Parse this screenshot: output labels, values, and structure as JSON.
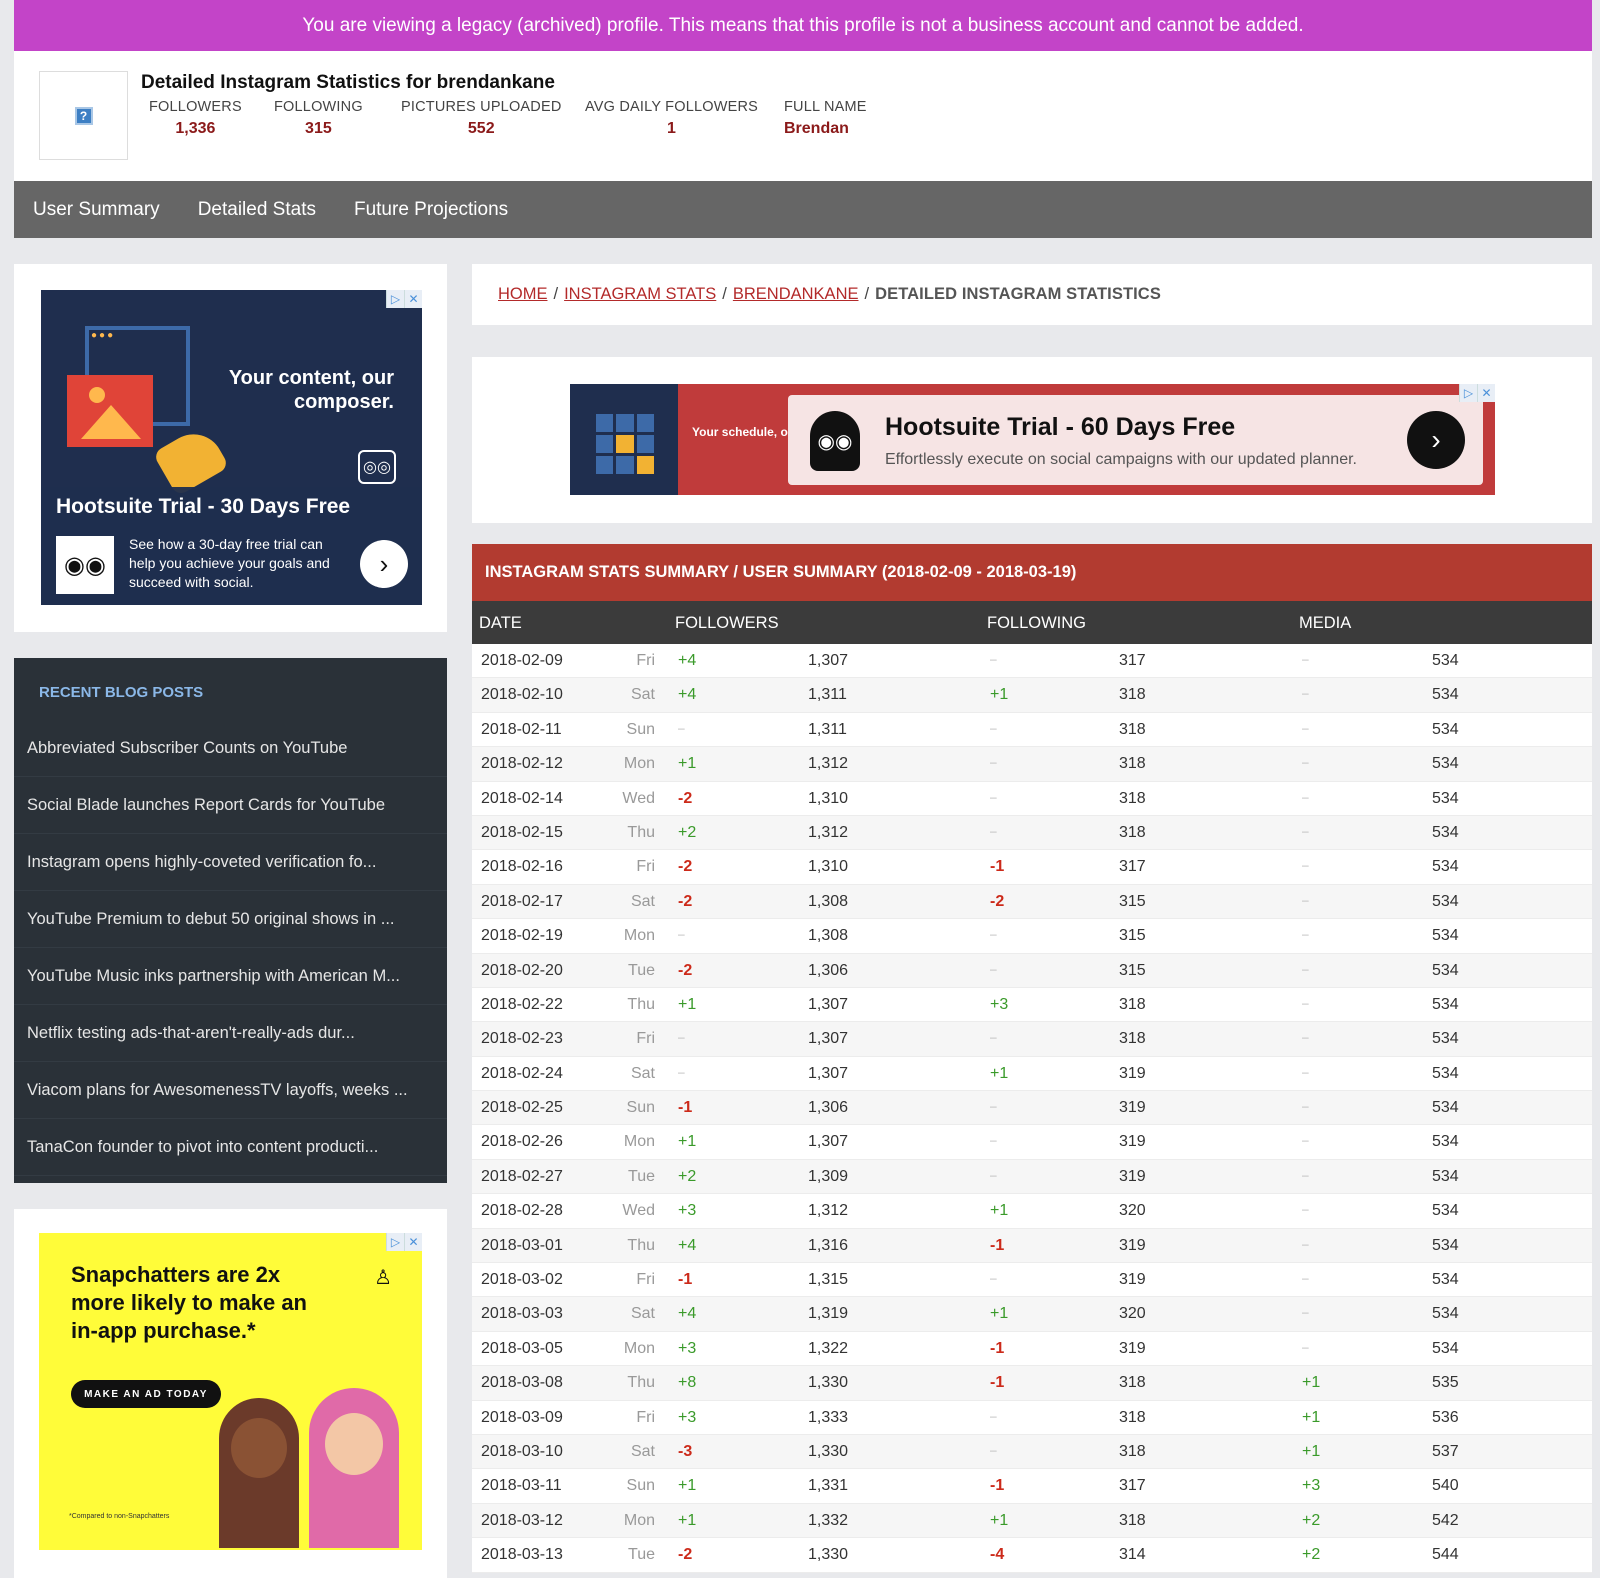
{
  "banner": "You are viewing a legacy (archived) profile. This means that this profile is not a business account and cannot be added.",
  "profile": {
    "avatar_glyph": "?",
    "title": "Detailed Instagram Statistics for brendankane",
    "stats": [
      {
        "label": "FOLLOWERS",
        "value": "1,336"
      },
      {
        "label": "FOLLOWING",
        "value": "315"
      },
      {
        "label": "PICTURES UPLOADED",
        "value": "552"
      },
      {
        "label": "AVG DAILY FOLLOWERS",
        "value": "1"
      },
      {
        "label": "FULL NAME",
        "value": "Brendan"
      }
    ]
  },
  "nav": [
    "User Summary",
    "Detailed Stats",
    "Future Projections"
  ],
  "ad_left": {
    "headline": "Your content, our composer.",
    "title": "Hootsuite Trial - 30 Days Free",
    "text": "See how a 30-day free trial can help you achieve your goals and succeed with social.",
    "cta": "›"
  },
  "blog": {
    "title": "RECENT BLOG POSTS",
    "items": [
      "Abbreviated Subscriber Counts on YouTube",
      "Social Blade launches Report Cards for YouTube",
      "Instagram opens highly-coveted verification fo...",
      "YouTube Premium to debut 50 original shows in ...",
      "YouTube Music inks partnership with American M...",
      "Netflix testing ads-that-aren't-really-ads dur...",
      "Viacom plans for AwesomenessTV layoffs, weeks ...",
      "TanaCon founder to pivot into content producti..."
    ]
  },
  "ad_snap": {
    "headline": "Snapchatters are 2x more likely to make an in-app purchase.*",
    "button": "MAKE AN AD TODAY",
    "fine": "*Compared to non-Snapchatters"
  },
  "breadcrumb": {
    "home": "HOME",
    "stats": "INSTAGRAM STATS",
    "user": "BRENDANKANE",
    "current": "DETAILED INSTAGRAM STATISTICS",
    "sep": "/"
  },
  "ad_top": {
    "schedule": "Your schedule, our planner.",
    "title": "Hootsuite Trial - 60 Days Free",
    "sub": "Effortlessly execute on social campaigns with our updated planner.",
    "cta": "›"
  },
  "table": {
    "header": "INSTAGRAM STATS SUMMARY / USER SUMMARY (2018-02-09 - 2018-03-19)",
    "columns": [
      "DATE",
      "FOLLOWERS",
      "FOLLOWING",
      "MEDIA"
    ],
    "rows": [
      [
        "2018-02-09",
        "Fri",
        "+4",
        "1,307",
        "–",
        "317",
        "–",
        "534"
      ],
      [
        "2018-02-10",
        "Sat",
        "+4",
        "1,311",
        "+1",
        "318",
        "–",
        "534"
      ],
      [
        "2018-02-11",
        "Sun",
        "–",
        "1,311",
        "–",
        "318",
        "–",
        "534"
      ],
      [
        "2018-02-12",
        "Mon",
        "+1",
        "1,312",
        "–",
        "318",
        "–",
        "534"
      ],
      [
        "2018-02-14",
        "Wed",
        "-2",
        "1,310",
        "–",
        "318",
        "–",
        "534"
      ],
      [
        "2018-02-15",
        "Thu",
        "+2",
        "1,312",
        "–",
        "318",
        "–",
        "534"
      ],
      [
        "2018-02-16",
        "Fri",
        "-2",
        "1,310",
        "-1",
        "317",
        "–",
        "534"
      ],
      [
        "2018-02-17",
        "Sat",
        "-2",
        "1,308",
        "-2",
        "315",
        "–",
        "534"
      ],
      [
        "2018-02-19",
        "Mon",
        "–",
        "1,308",
        "–",
        "315",
        "–",
        "534"
      ],
      [
        "2018-02-20",
        "Tue",
        "-2",
        "1,306",
        "–",
        "315",
        "–",
        "534"
      ],
      [
        "2018-02-22",
        "Thu",
        "+1",
        "1,307",
        "+3",
        "318",
        "–",
        "534"
      ],
      [
        "2018-02-23",
        "Fri",
        "–",
        "1,307",
        "–",
        "318",
        "–",
        "534"
      ],
      [
        "2018-02-24",
        "Sat",
        "–",
        "1,307",
        "+1",
        "319",
        "–",
        "534"
      ],
      [
        "2018-02-25",
        "Sun",
        "-1",
        "1,306",
        "–",
        "319",
        "–",
        "534"
      ],
      [
        "2018-02-26",
        "Mon",
        "+1",
        "1,307",
        "–",
        "319",
        "–",
        "534"
      ],
      [
        "2018-02-27",
        "Tue",
        "+2",
        "1,309",
        "–",
        "319",
        "–",
        "534"
      ],
      [
        "2018-02-28",
        "Wed",
        "+3",
        "1,312",
        "+1",
        "320",
        "–",
        "534"
      ],
      [
        "2018-03-01",
        "Thu",
        "+4",
        "1,316",
        "-1",
        "319",
        "–",
        "534"
      ],
      [
        "2018-03-02",
        "Fri",
        "-1",
        "1,315",
        "–",
        "319",
        "–",
        "534"
      ],
      [
        "2018-03-03",
        "Sat",
        "+4",
        "1,319",
        "+1",
        "320",
        "–",
        "534"
      ],
      [
        "2018-03-05",
        "Mon",
        "+3",
        "1,322",
        "-1",
        "319",
        "–",
        "534"
      ],
      [
        "2018-03-08",
        "Thu",
        "+8",
        "1,330",
        "-1",
        "318",
        "+1",
        "535"
      ],
      [
        "2018-03-09",
        "Fri",
        "+3",
        "1,333",
        "–",
        "318",
        "+1",
        "536"
      ],
      [
        "2018-03-10",
        "Sat",
        "-3",
        "1,330",
        "–",
        "318",
        "+1",
        "537"
      ],
      [
        "2018-03-11",
        "Sun",
        "+1",
        "1,331",
        "-1",
        "317",
        "+3",
        "540"
      ],
      [
        "2018-03-12",
        "Mon",
        "+1",
        "1,332",
        "+1",
        "318",
        "+2",
        "542"
      ],
      [
        "2018-03-13",
        "Tue",
        "-2",
        "1,330",
        "-4",
        "314",
        "+2",
        "544"
      ]
    ]
  },
  "colors": {
    "banner": "#c344c8",
    "accent_red": "#b23b30",
    "positive": "#3a9a2a",
    "negative": "#cc2a1a"
  }
}
